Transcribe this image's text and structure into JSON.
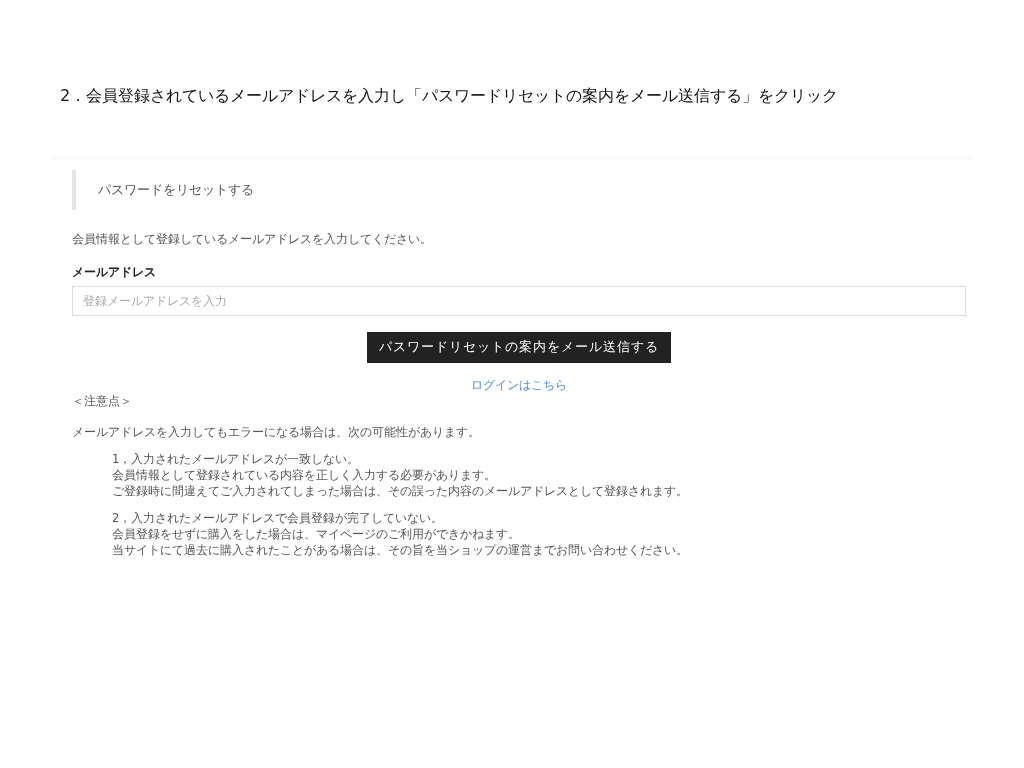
{
  "instruction": "2．会員登録されているメールアドレスを入力し「パスワードリセットの案内をメール送信する」をクリック",
  "page_title": "パスワードをリセットする",
  "intro": "会員情報として登録しているメールアドレスを入力してください。",
  "email_field": {
    "label": "メールアドレス",
    "placeholder": "登録メールアドレスを入力"
  },
  "submit_button": "パスワードリセットの案内をメール送信する",
  "login_link": "ログインはこちら",
  "notes_heading": "＜注意点＞",
  "notes_intro": "メールアドレスを入力してもエラーになる場合は、次の可能性があります。",
  "notes": [
    {
      "lines": [
        "1，入力されたメールアドレスが一致しない。",
        "会員情報として登録されている内容を正しく入力する必要があります。",
        "ご登録時に間違えてご入力されてしまった場合は、その誤った内容のメールアドレスとして登録されます。"
      ]
    },
    {
      "lines": [
        "2，入力されたメールアドレスで会員登録が完了していない。",
        "会員登録をせずに購入をした場合は、マイページのご利用ができかねます。",
        "当サイトにて過去に購入されたことがある場合は、その旨を当ショップの運営までお問い合わせください。"
      ]
    }
  ]
}
